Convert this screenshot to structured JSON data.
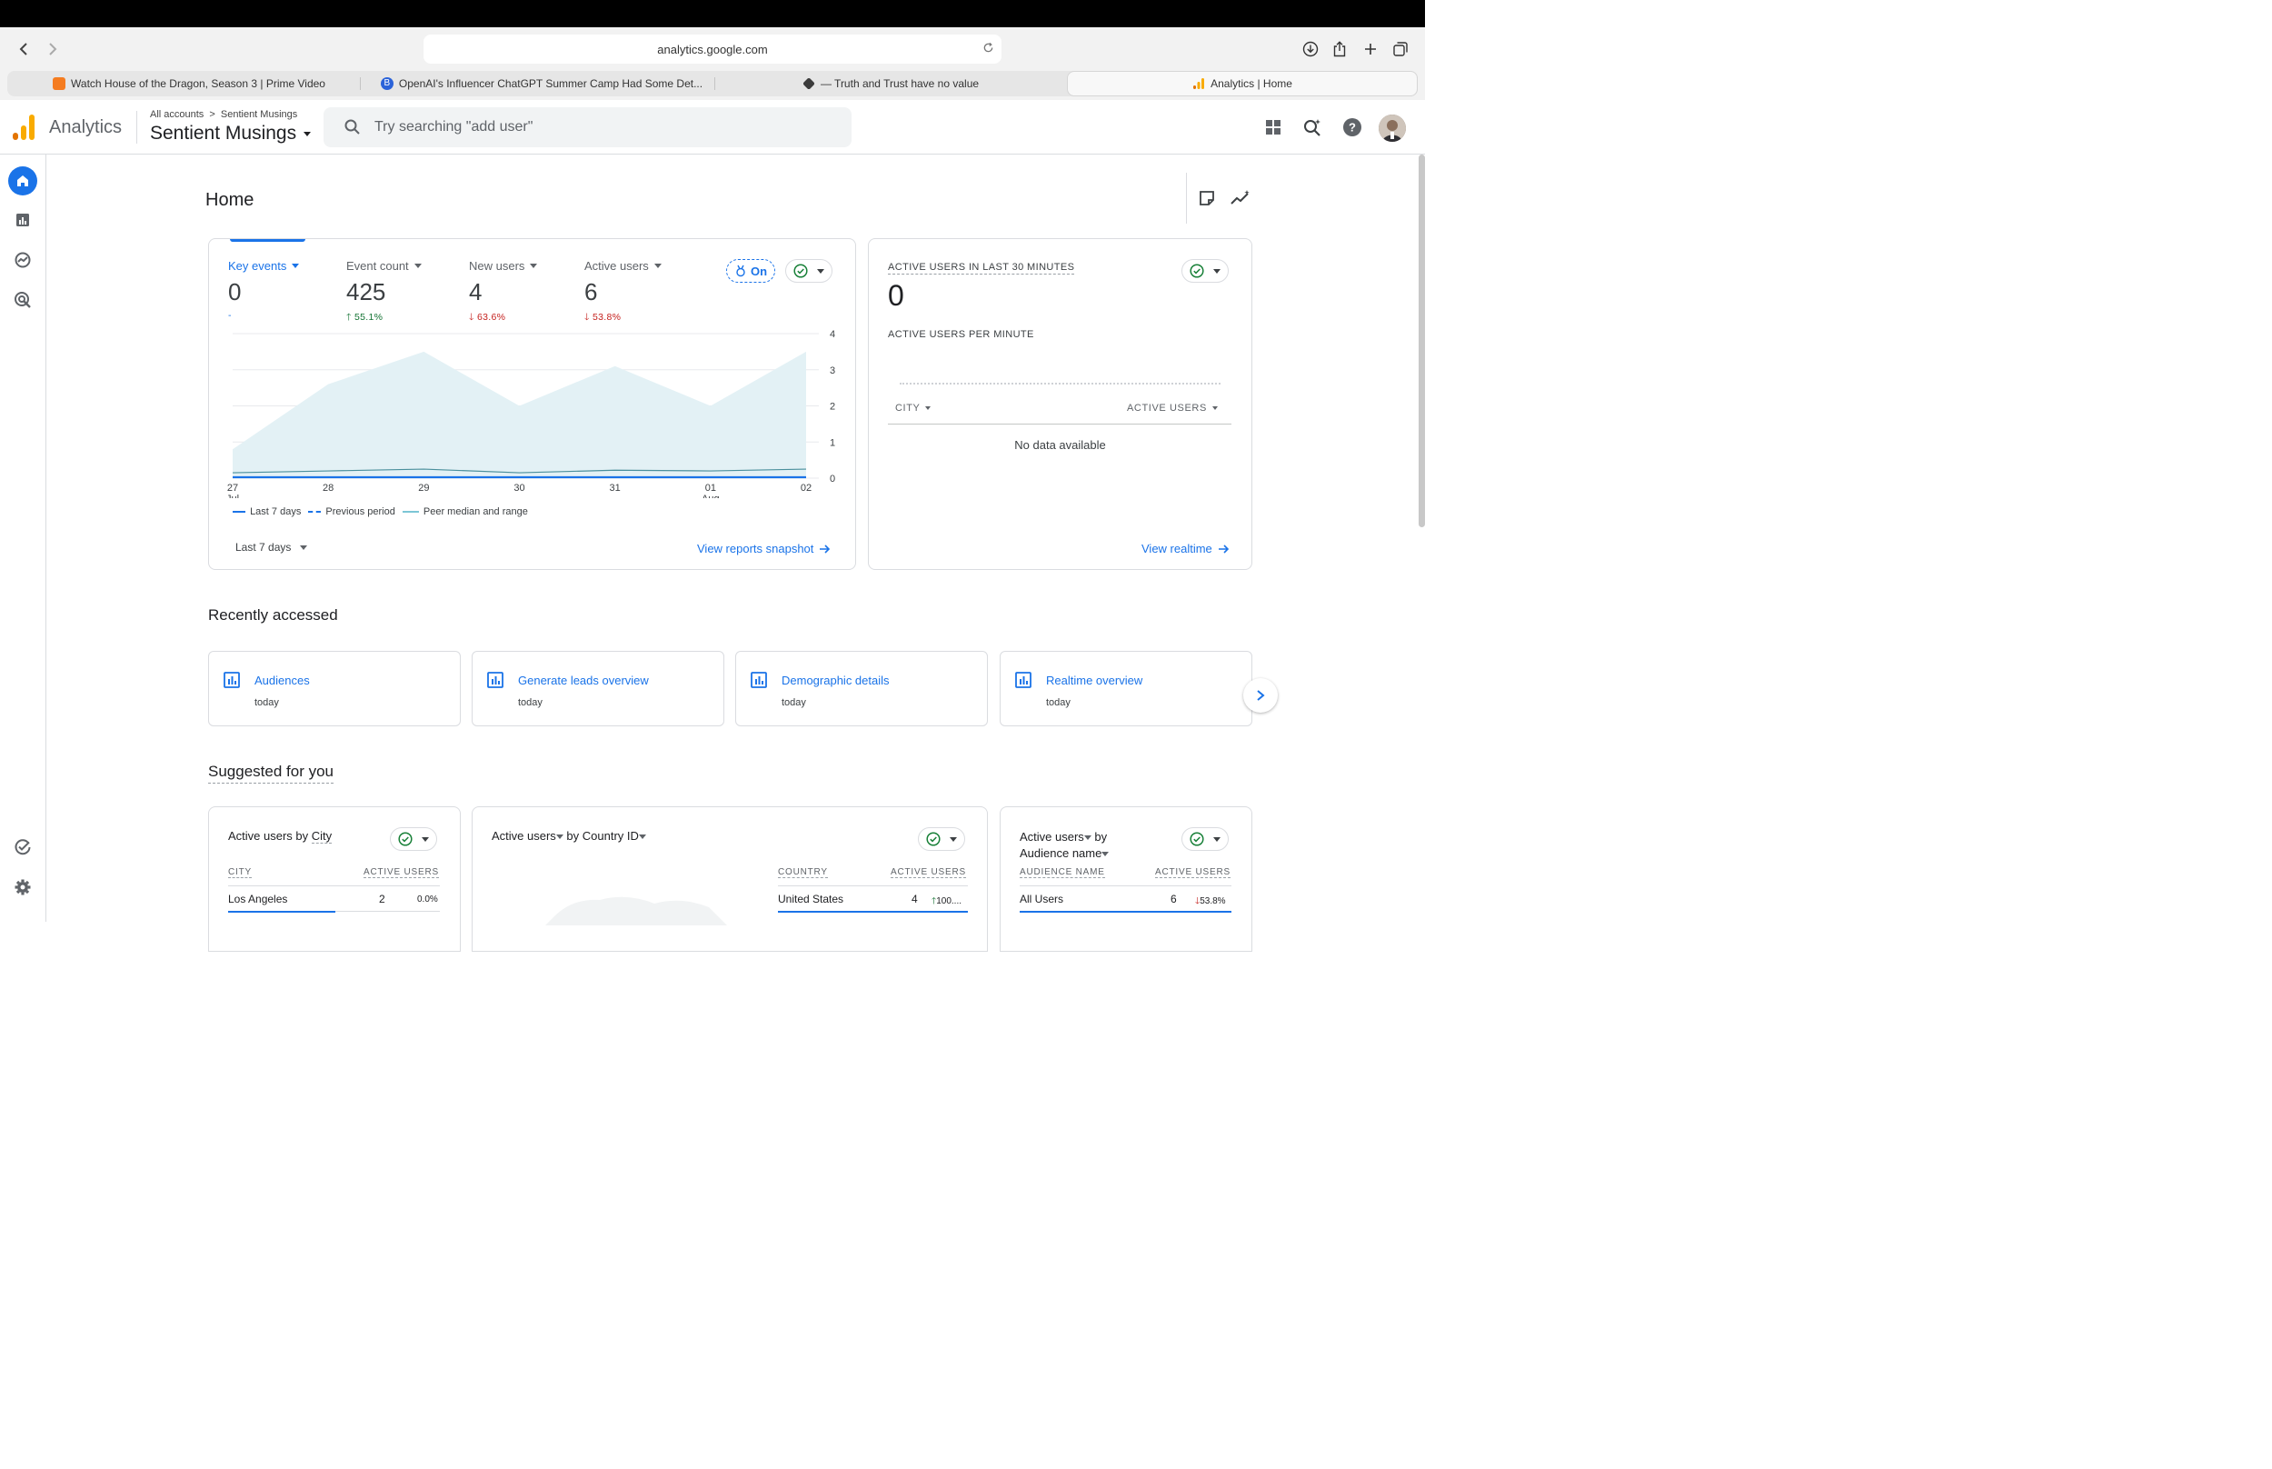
{
  "browser": {
    "url": "analytics.google.com",
    "tabs": [
      {
        "title": "Watch House of the Dragon, Season 3 | Prime Video"
      },
      {
        "title": "OpenAI's Influencer ChatGPT Summer Camp Had Some Det..."
      },
      {
        "title": "— Truth and Trust have no value"
      },
      {
        "title": "Analytics | Home"
      }
    ]
  },
  "header": {
    "app_name": "Analytics",
    "breadcrumb_root": "All accounts",
    "breadcrumb_child": "Sentient Musings",
    "property_name": "Sentient Musings",
    "search_placeholder": "Try searching \"add user\""
  },
  "page": {
    "title": "Home"
  },
  "overview": {
    "metrics": [
      {
        "label": "Key events",
        "value": "0",
        "delta": "-",
        "direction": "none"
      },
      {
        "label": "Event count",
        "value": "425",
        "delta": "55.1%",
        "direction": "up"
      },
      {
        "label": "New users",
        "value": "4",
        "delta": "63.6%",
        "direction": "down"
      },
      {
        "label": "Active users",
        "value": "6",
        "delta": "53.8%",
        "direction": "down"
      }
    ],
    "on_badge": "On",
    "date_range": "Last 7 days",
    "view_link": "View reports snapshot"
  },
  "chart_data": {
    "type": "area",
    "x": [
      "27 Jul",
      "28",
      "29",
      "30",
      "31",
      "01 Aug",
      "02"
    ],
    "x_tick_labels": [
      [
        "27",
        "Jul"
      ],
      [
        "28",
        ""
      ],
      [
        "29",
        ""
      ],
      [
        "30",
        ""
      ],
      [
        "31",
        ""
      ],
      [
        "01",
        "Aug"
      ],
      [
        "02",
        ""
      ]
    ],
    "ylim": [
      0,
      4
    ],
    "y_ticks": [
      "0",
      "1",
      "2",
      "3",
      "4"
    ],
    "grid": true,
    "series": [
      {
        "name": "Last 7 days",
        "values": [
          0,
          0,
          0,
          0,
          0,
          0,
          0
        ],
        "color": "#1a73e8"
      },
      {
        "name": "Previous period",
        "values": [
          0.15,
          0.2,
          0.25,
          0.15,
          0.22,
          0.2,
          0.25
        ],
        "color": "#1a73e8"
      },
      {
        "name": "Peer median and range",
        "values": [
          0.8,
          2.6,
          3.5,
          2.0,
          3.1,
          2.0,
          3.5
        ],
        "color": "#a8dbe6"
      }
    ],
    "legend": [
      "Last 7 days",
      "Previous period",
      "Peer median and range"
    ],
    "legend_position": "bottom-left"
  },
  "realtime": {
    "title": "ACTIVE USERS IN LAST 30 MINUTES",
    "value": "0",
    "per_minute_label": "ACTIVE USERS PER MINUTE",
    "col_city": "CITY",
    "col_active": "ACTIVE USERS",
    "empty_text": "No data available",
    "view_link": "View realtime"
  },
  "recent": {
    "title": "Recently accessed",
    "items": [
      {
        "title": "Audiences",
        "when": "today"
      },
      {
        "title": "Generate leads overview",
        "when": "today"
      },
      {
        "title": "Demographic details",
        "when": "today"
      },
      {
        "title": "Realtime overview",
        "when": "today"
      }
    ]
  },
  "suggested": {
    "title": "Suggested for you",
    "cards": [
      {
        "title_a": "Active users by ",
        "title_b": "City",
        "col1": "CITY",
        "col2": "ACTIVE USERS",
        "row_name": "Los Angeles",
        "row_value": "2",
        "row_delta": "0.0%"
      },
      {
        "title_a": "Active users",
        "title_b": " by Country ID",
        "col1": "COUNTRY",
        "col2": "ACTIVE USERS",
        "row_name": "United States",
        "row_value": "4",
        "row_delta": "100...."
      },
      {
        "title_a": "Active users",
        "title_b": " by",
        "title_c": "Audience name",
        "col1": "AUDIENCE NAME",
        "col2": "ACTIVE USERS",
        "row_name": "All Users",
        "row_value": "6",
        "row_delta": "53.8%"
      }
    ]
  },
  "colors": {
    "accent": "#1a73e8",
    "up": "#137333",
    "down": "#c5221f",
    "peer_fill": "#e3f1f5",
    "logo_orange": "#f9ab00",
    "logo_dark_orange": "#e37400"
  }
}
